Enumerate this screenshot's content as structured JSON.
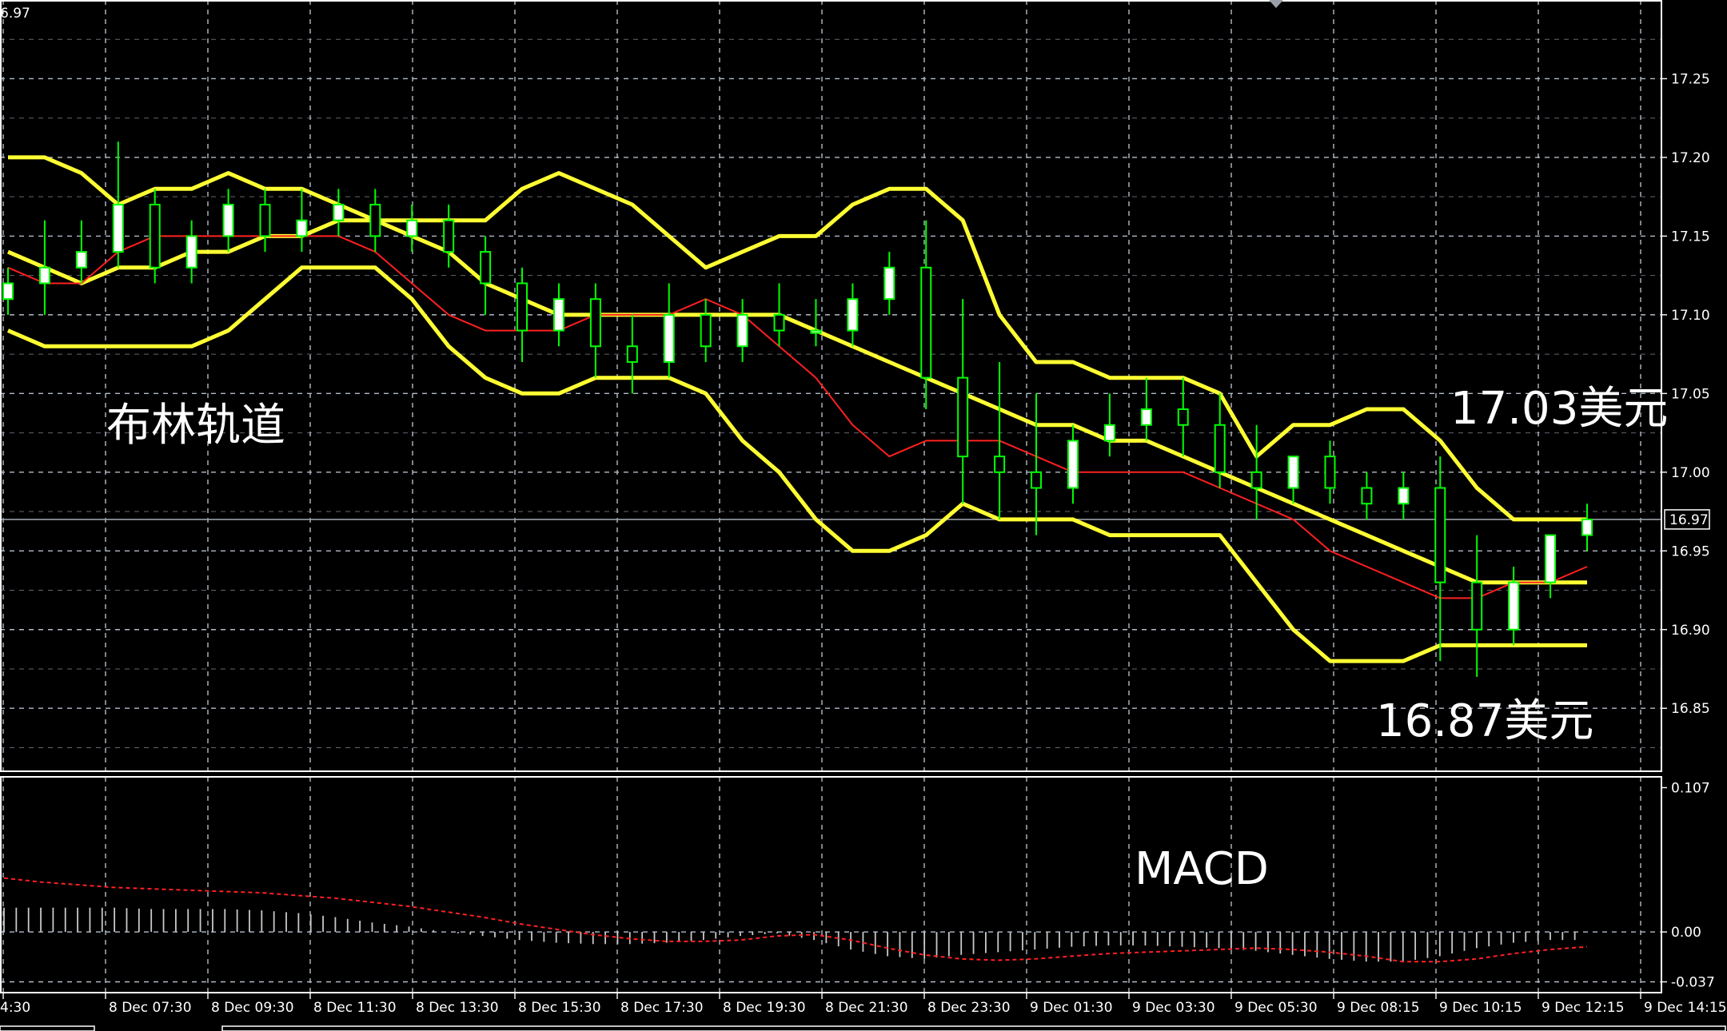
{
  "chart_data": {
    "type": "candlestick",
    "main": {
      "ylim": [
        16.81,
        17.3
      ],
      "y_ticks": [
        "17.25",
        "17.20",
        "17.15",
        "17.10",
        "17.05",
        "17.00",
        "16.95",
        "16.90",
        "16.85"
      ],
      "current_price": "16.97",
      "corner_value": "6.97",
      "x_ticks": [
        "4:30",
        "8 Dec 07:30",
        "8 Dec 09:30",
        "8 Dec 11:30",
        "8 Dec 13:30",
        "8 Dec 15:30",
        "8 Dec 17:30",
        "8 Dec 19:30",
        "8 Dec 21:30",
        "8 Dec 23:30",
        "9 Dec 01:30",
        "9 Dec 03:30",
        "9 Dec 05:30",
        "9 Dec 08:15",
        "9 Dec 10:15",
        "9 Dec 12:15",
        "9 Dec 14:15"
      ],
      "bollinger_upper": [
        17.2,
        17.2,
        17.19,
        17.17,
        17.18,
        17.18,
        17.19,
        17.18,
        17.18,
        17.17,
        17.16,
        17.16,
        17.16,
        17.16,
        17.18,
        17.19,
        17.18,
        17.17,
        17.15,
        17.13,
        17.14,
        17.15,
        17.15,
        17.17,
        17.18,
        17.18,
        17.16,
        17.1,
        17.07,
        17.07,
        17.06,
        17.06,
        17.06,
        17.05,
        17.01,
        17.03,
        17.03,
        17.04,
        17.04,
        17.02,
        16.99,
        16.97,
        16.97,
        16.97
      ],
      "bollinger_middle": [
        17.14,
        17.13,
        17.12,
        17.13,
        17.13,
        17.14,
        17.14,
        17.15,
        17.15,
        17.16,
        17.16,
        17.15,
        17.14,
        17.12,
        17.11,
        17.1,
        17.1,
        17.1,
        17.1,
        17.1,
        17.1,
        17.1,
        17.09,
        17.08,
        17.07,
        17.06,
        17.05,
        17.04,
        17.03,
        17.03,
        17.02,
        17.02,
        17.01,
        17.0,
        16.99,
        16.98,
        16.97,
        16.96,
        16.95,
        16.94,
        16.93,
        16.93,
        16.93,
        16.93
      ],
      "bollinger_lower": [
        17.09,
        17.08,
        17.08,
        17.08,
        17.08,
        17.08,
        17.09,
        17.11,
        17.13,
        17.13,
        17.13,
        17.11,
        17.08,
        17.06,
        17.05,
        17.05,
        17.06,
        17.06,
        17.06,
        17.05,
        17.02,
        17.0,
        16.97,
        16.95,
        16.95,
        16.96,
        16.98,
        16.97,
        16.97,
        16.97,
        16.96,
        16.96,
        16.96,
        16.96,
        16.93,
        16.9,
        16.88,
        16.88,
        16.88,
        16.89,
        16.89,
        16.89,
        16.89,
        16.89
      ],
      "sma": [
        17.13,
        17.12,
        17.12,
        17.14,
        17.15,
        17.15,
        17.15,
        17.15,
        17.15,
        17.15,
        17.14,
        17.12,
        17.1,
        17.09,
        17.09,
        17.09,
        17.1,
        17.1,
        17.1,
        17.11,
        17.1,
        17.08,
        17.06,
        17.03,
        17.01,
        17.02,
        17.02,
        17.02,
        17.01,
        17.0,
        17.0,
        17.0,
        17.0,
        16.99,
        16.98,
        16.97,
        16.95,
        16.94,
        16.93,
        16.92,
        16.92,
        16.93,
        16.93,
        16.94
      ],
      "candles": [
        [
          17.11,
          17.13,
          17.12,
          17.1
        ],
        [
          17.12,
          17.16,
          17.13,
          17.1
        ],
        [
          17.13,
          17.16,
          17.14,
          17.12
        ],
        [
          17.14,
          17.21,
          17.17,
          17.13
        ],
        [
          17.17,
          17.18,
          17.13,
          17.12
        ],
        [
          17.13,
          17.16,
          17.15,
          17.12
        ],
        [
          17.15,
          17.18,
          17.17,
          17.14
        ],
        [
          17.17,
          17.18,
          17.15,
          17.14
        ],
        [
          17.15,
          17.18,
          17.16,
          17.14
        ],
        [
          17.16,
          17.18,
          17.17,
          17.15
        ],
        [
          17.17,
          17.18,
          17.15,
          17.14
        ],
        [
          17.15,
          17.17,
          17.16,
          17.14
        ],
        [
          17.16,
          17.17,
          17.14,
          17.13
        ],
        [
          17.14,
          17.15,
          17.12,
          17.1
        ],
        [
          17.12,
          17.13,
          17.09,
          17.07
        ],
        [
          17.09,
          17.12,
          17.11,
          17.08
        ],
        [
          17.11,
          17.12,
          17.08,
          17.06
        ],
        [
          17.08,
          17.1,
          17.07,
          17.05
        ],
        [
          17.07,
          17.12,
          17.1,
          17.06
        ],
        [
          17.1,
          17.11,
          17.08,
          17.07
        ],
        [
          17.08,
          17.11,
          17.1,
          17.07
        ],
        [
          17.1,
          17.12,
          17.09,
          17.08
        ],
        [
          17.09,
          17.11,
          17.09,
          17.08
        ],
        [
          17.09,
          17.12,
          17.11,
          17.08
        ],
        [
          17.11,
          17.14,
          17.13,
          17.1
        ],
        [
          17.13,
          17.16,
          17.06,
          17.04
        ],
        [
          17.06,
          17.11,
          17.01,
          16.98
        ],
        [
          17.01,
          17.07,
          17.0,
          16.97
        ],
        [
          17.0,
          17.05,
          16.99,
          16.96
        ],
        [
          16.99,
          17.03,
          17.02,
          16.98
        ],
        [
          17.02,
          17.05,
          17.03,
          17.01
        ],
        [
          17.03,
          17.06,
          17.04,
          17.02
        ],
        [
          17.04,
          17.06,
          17.03,
          17.01
        ],
        [
          17.03,
          17.05,
          17.0,
          16.99
        ],
        [
          17.0,
          17.03,
          16.99,
          16.97
        ],
        [
          16.99,
          17.01,
          17.01,
          16.98
        ],
        [
          17.01,
          17.02,
          16.99,
          16.98
        ],
        [
          16.99,
          17.0,
          16.98,
          16.97
        ],
        [
          16.98,
          17.0,
          16.99,
          16.97
        ],
        [
          16.99,
          17.01,
          16.93,
          16.88
        ],
        [
          16.93,
          16.96,
          16.9,
          16.87
        ],
        [
          16.9,
          16.94,
          16.93,
          16.89
        ],
        [
          16.93,
          16.95,
          16.96,
          16.92
        ],
        [
          16.96,
          16.98,
          16.97,
          16.95
        ]
      ]
    },
    "macd": {
      "ylim": [
        -0.045,
        0.115
      ],
      "y_ticks": [
        "0.107",
        "0.00",
        "-0.037"
      ],
      "histogram": [
        0.018,
        0.018,
        0.018,
        0.018,
        0.017,
        0.017,
        0.017,
        0.016,
        0.014,
        0.011,
        0.007,
        0.004,
        0.0,
        -0.003,
        -0.006,
        -0.008,
        -0.009,
        -0.009,
        -0.008,
        -0.006,
        -0.003,
        -0.001,
        -0.006,
        -0.013,
        -0.018,
        -0.02,
        -0.017,
        -0.015,
        -0.013,
        -0.011,
        -0.01,
        -0.01,
        -0.011,
        -0.012,
        -0.014,
        -0.017,
        -0.02,
        -0.022,
        -0.022,
        -0.018,
        -0.012,
        -0.008,
        -0.006,
        -0.006
      ],
      "signal": [
        0.04,
        0.037,
        0.035,
        0.033,
        0.032,
        0.031,
        0.03,
        0.029,
        0.027,
        0.025,
        0.022,
        0.019,
        0.015,
        0.011,
        0.006,
        0.002,
        -0.002,
        -0.005,
        -0.007,
        -0.007,
        -0.006,
        -0.003,
        -0.002,
        -0.006,
        -0.012,
        -0.017,
        -0.02,
        -0.021,
        -0.02,
        -0.018,
        -0.016,
        -0.015,
        -0.014,
        -0.013,
        -0.012,
        -0.013,
        -0.015,
        -0.018,
        -0.022,
        -0.022,
        -0.02,
        -0.016,
        -0.013,
        -0.011
      ]
    },
    "colors": {
      "background": "#000000",
      "grid": "#B4BCC8",
      "frame": "#FFFFFF",
      "candle_up": "#FFFFFF",
      "candle_down": "#000000",
      "candle_outline": "#00FF00",
      "bollinger": "#FFFF33",
      "sma": "#FF2020",
      "macd_histogram": "#C8C8C8",
      "macd_signal": "#FF2020",
      "axis_text": "#FFFFFF"
    }
  },
  "annotations": {
    "title": "布林轨道",
    "upper_price": "17.03美元",
    "lower_price": "16.87美元",
    "macd_label": "MACD"
  }
}
